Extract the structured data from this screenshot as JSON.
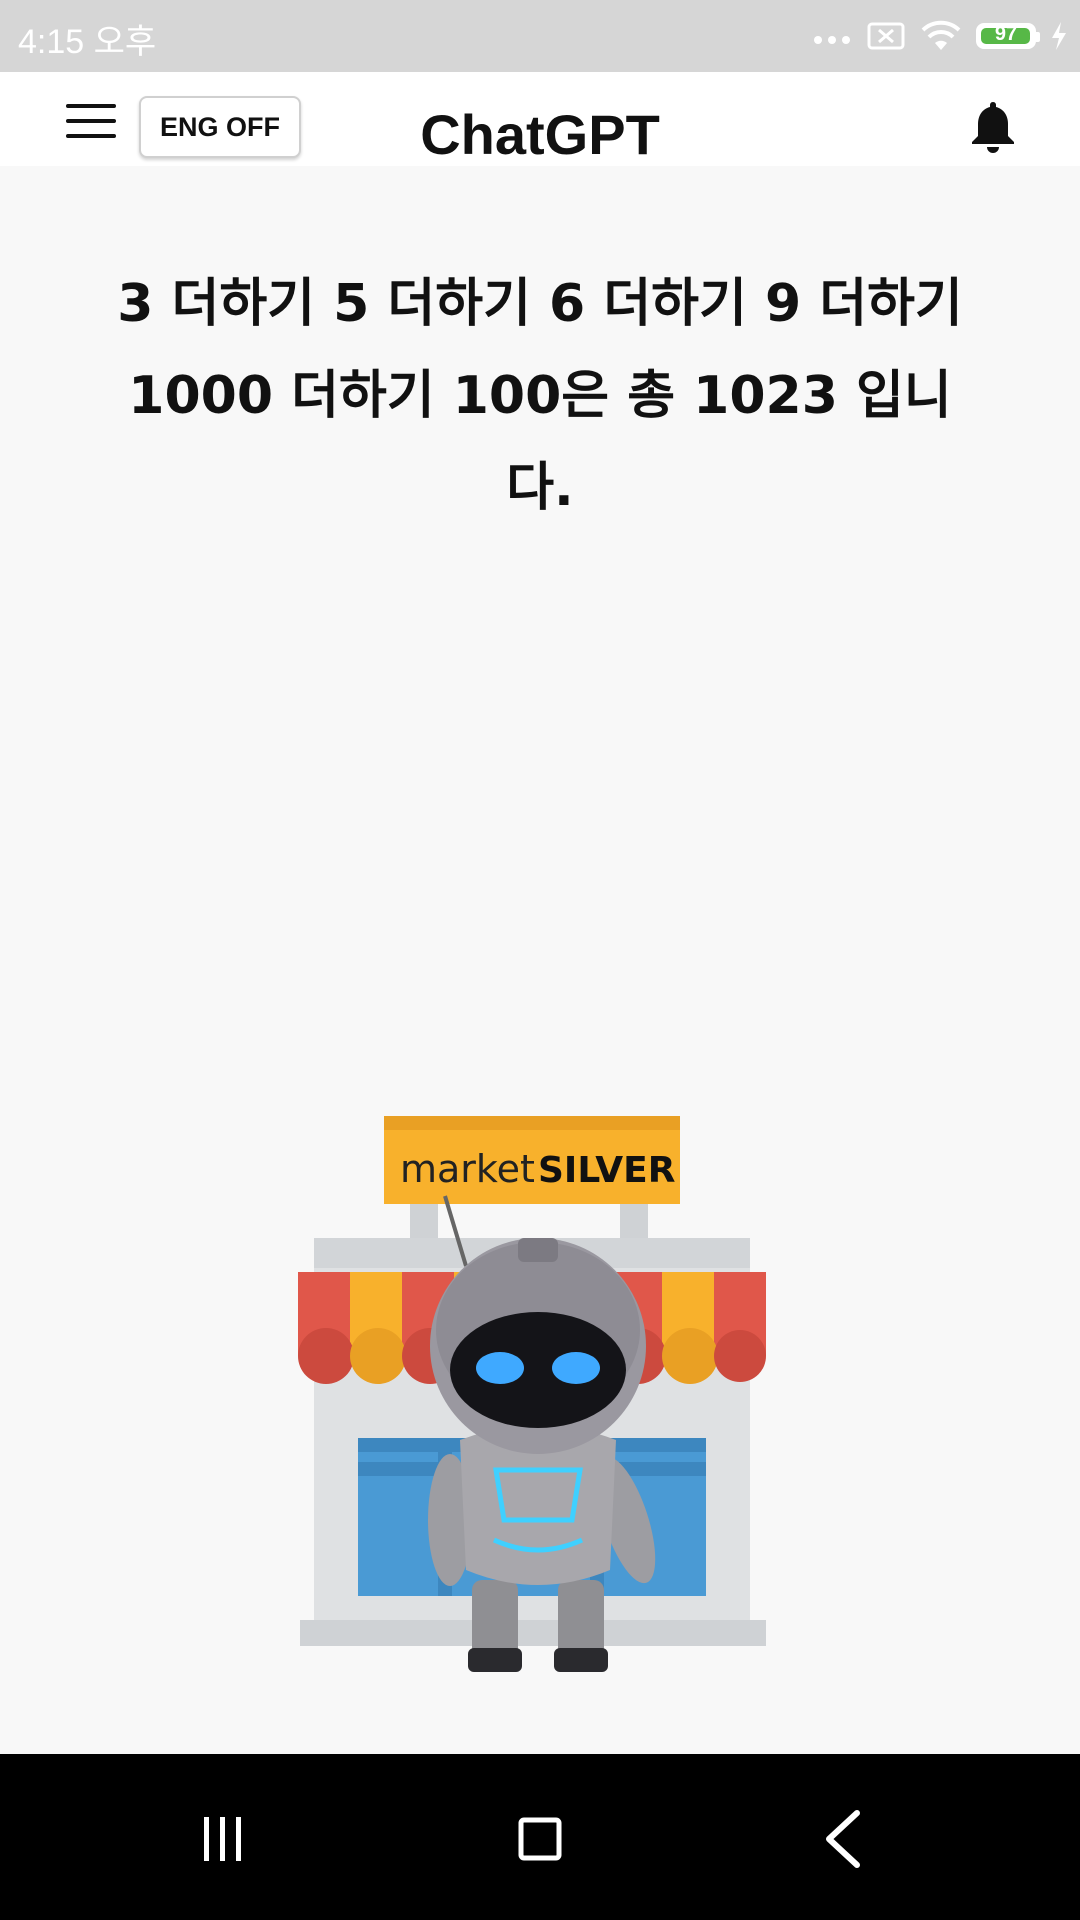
{
  "status_bar": {
    "time": "4:15 오후",
    "battery_level": "97",
    "battery_fraction": 0.97,
    "icons": [
      "more-dots-icon",
      "notification-blocked-icon",
      "wifi-icon",
      "battery-icon",
      "charging-bolt-icon"
    ]
  },
  "header": {
    "menu_icon": "hamburger-menu-icon",
    "eng_toggle_label": "ENG OFF",
    "title": "ChatGPT",
    "bell_icon": "bell-icon"
  },
  "main": {
    "answer_text": "3 더하기 5 더하기 6 더하기 9 더하기 1000 더하기 100은 총 1023 입니다."
  },
  "illustration": {
    "sign_text_regular": "market",
    "sign_text_bold": "SILVER",
    "colors": {
      "sign": "#f8b12c",
      "awning_red": "#e0574a",
      "awning_yellow": "#f8b12c",
      "window": "#4a9ad4",
      "building": "#dfe1e3",
      "robot_eye": "#3fa9ff"
    }
  },
  "nav_bar": {
    "icons": [
      "recents-icon",
      "home-icon",
      "back-icon"
    ]
  }
}
